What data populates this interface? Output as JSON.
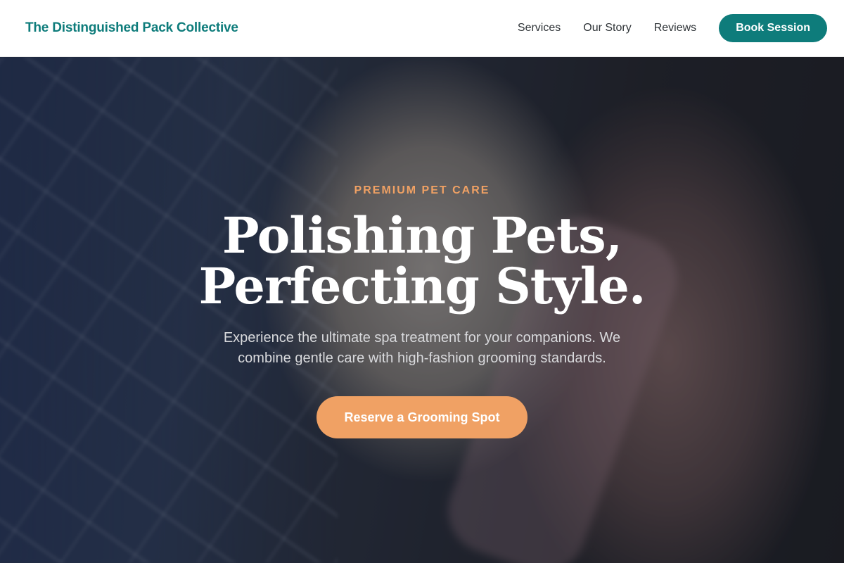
{
  "header": {
    "brand": "The Distinguished Pack Collective",
    "nav": [
      "Services",
      "Our Story",
      "Reviews"
    ],
    "cta": "Book Session"
  },
  "hero": {
    "eyebrow": "PREMIUM PET CARE",
    "headline_line1": "Polishing Pets,",
    "headline_line2": "Perfecting Style.",
    "subtitle": "Experience the ultimate spa treatment for your companions. We combine gentle care with high-fashion grooming standards.",
    "cta": "Reserve a Grooming Spot"
  },
  "colors": {
    "brand": "#0e7c7b",
    "accent": "#f0a164"
  }
}
